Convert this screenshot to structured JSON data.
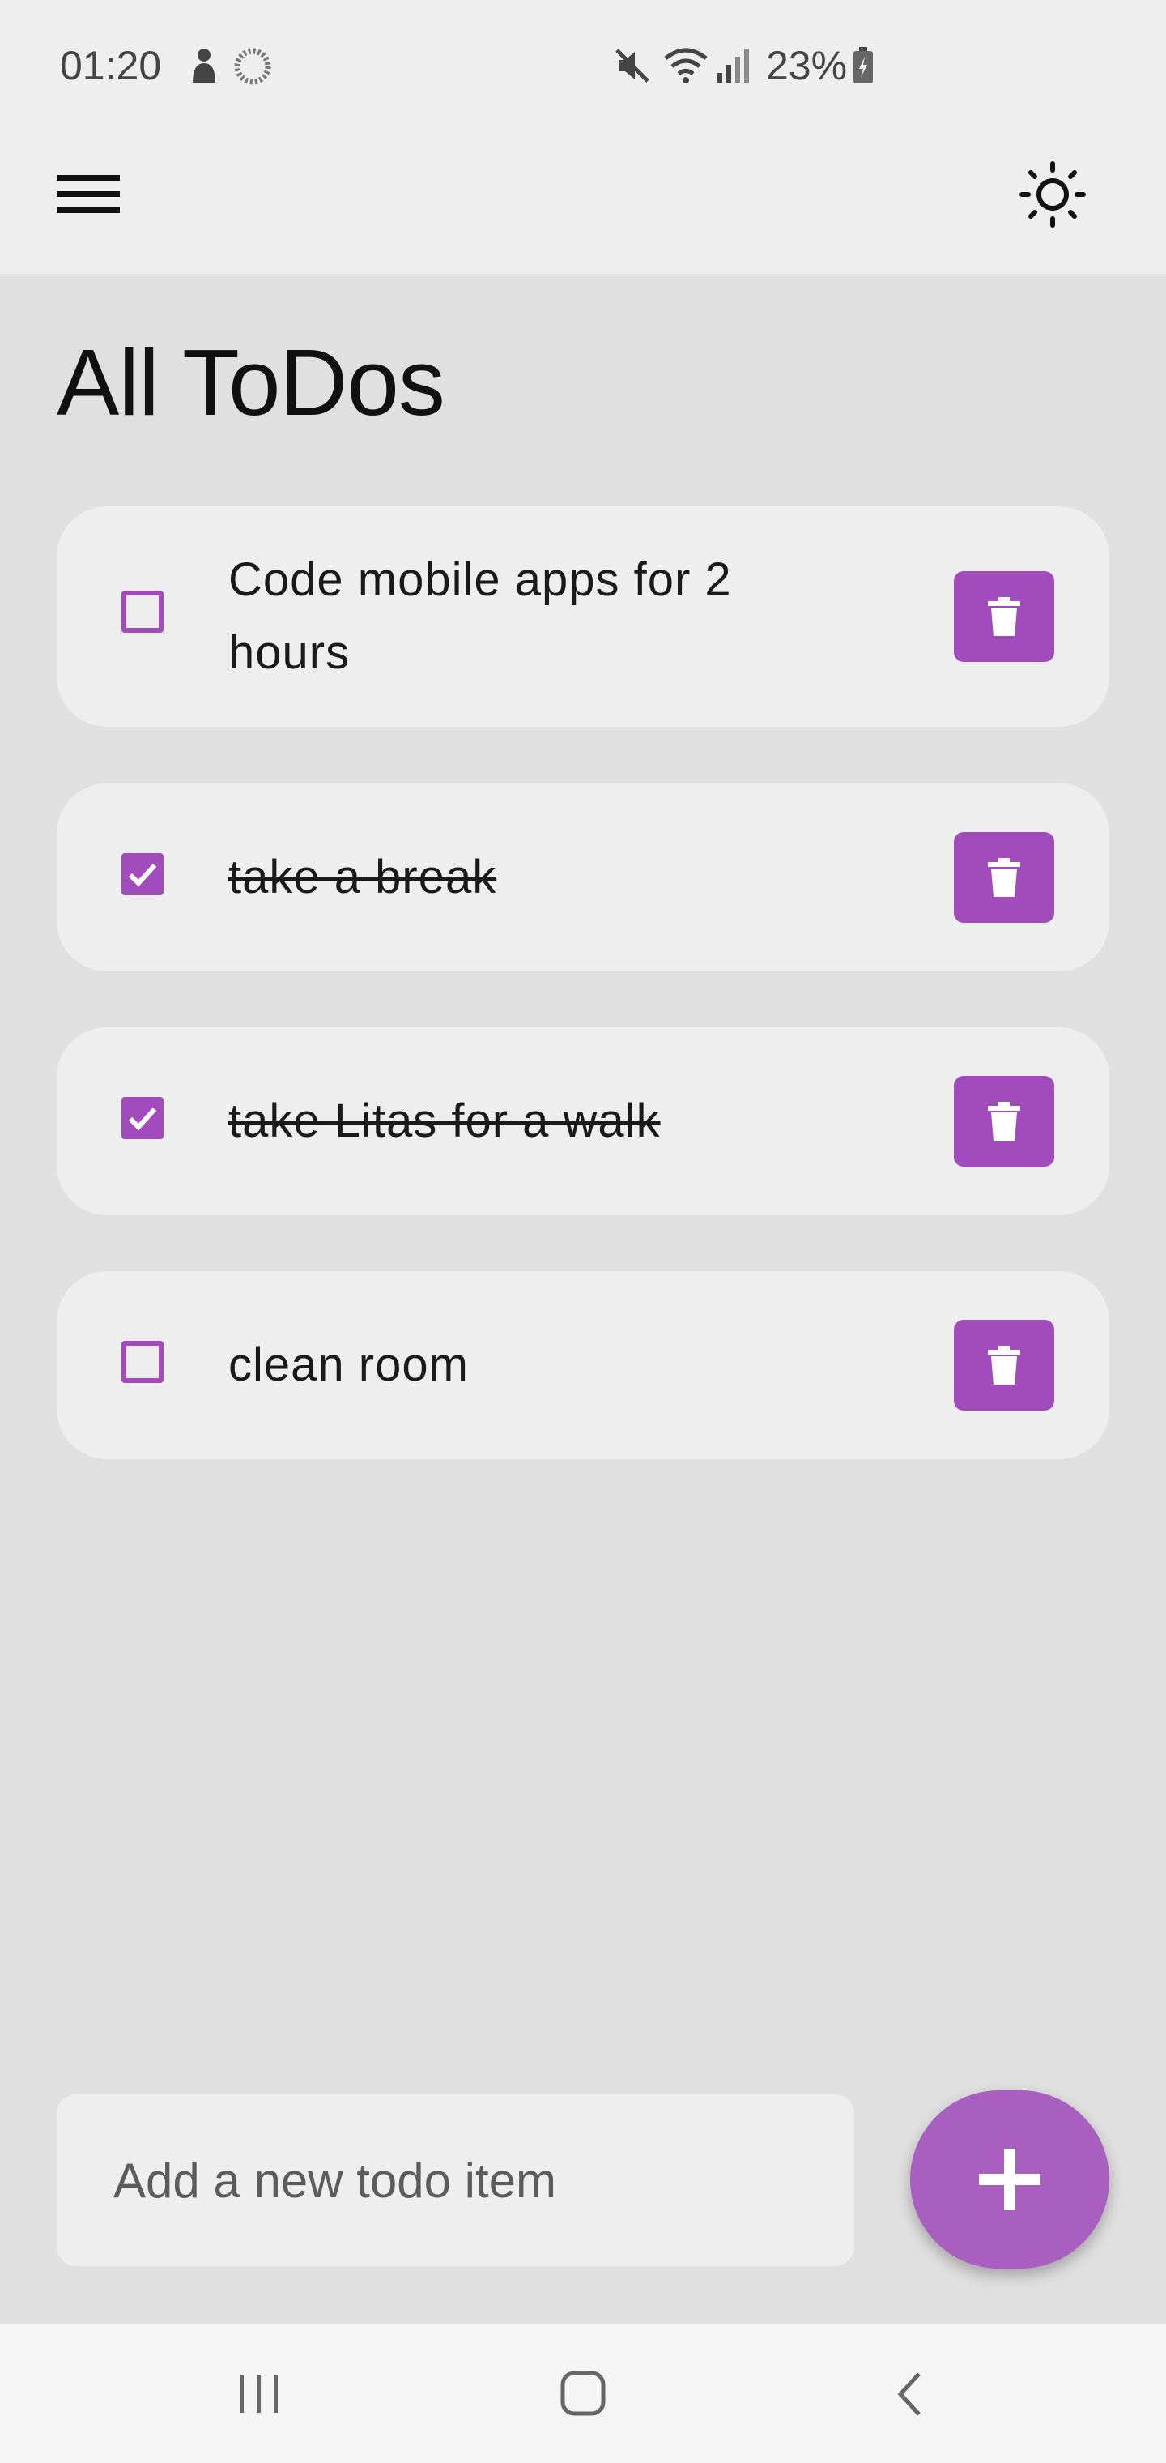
{
  "status_bar": {
    "time": "01:20",
    "battery": "23%",
    "icons": [
      "app-notification-icon",
      "loading-icon",
      "mute-icon",
      "wifi-icon",
      "signal-icon",
      "battery-charging-icon"
    ]
  },
  "app_bar": {
    "menu_icon": "hamburger-menu-icon",
    "theme_icon": "sun-icon"
  },
  "page": {
    "title": "All ToDos"
  },
  "todos": [
    {
      "text": "Code mobile apps for 2 hours",
      "done": false
    },
    {
      "text": "take a break",
      "done": true
    },
    {
      "text": "take Litas for a walk",
      "done": true
    },
    {
      "text": "clean room",
      "done": false
    }
  ],
  "new_todo": {
    "placeholder": "Add a new todo item",
    "add_icon": "plus-icon"
  },
  "colors": {
    "accent": "#a24bbd",
    "fab": "#a85fc0",
    "background": "#e0e0e0",
    "surface": "#eeeeee"
  },
  "nav_bar": {
    "icons": [
      "recent-apps-icon",
      "home-icon",
      "back-icon"
    ]
  }
}
